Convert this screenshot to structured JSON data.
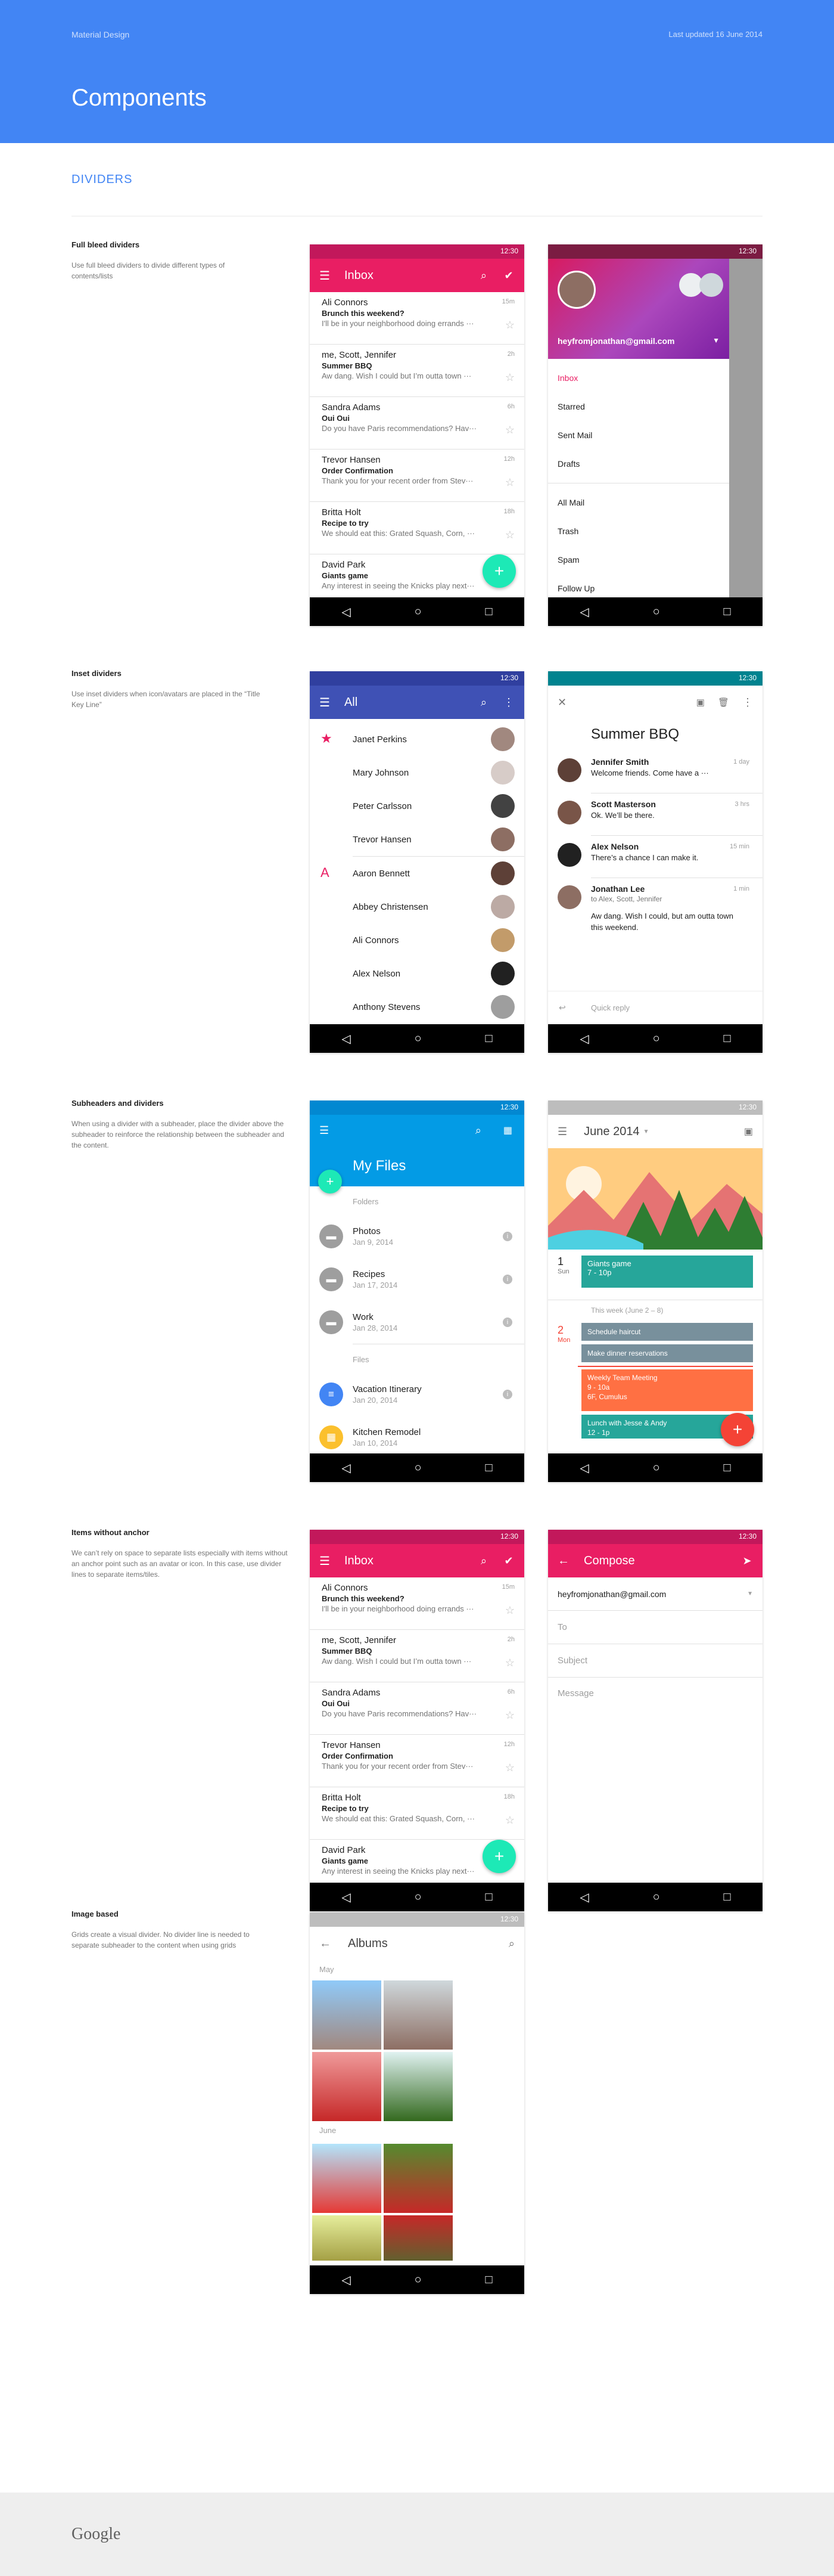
{
  "header": {
    "brand": "Material Design",
    "updated": "Last updated 16 June 2014",
    "title": "Components"
  },
  "section_title": "DIVIDERS",
  "colors": {
    "blue": "#4285f4",
    "pink": "#e91e63",
    "indigo": "#3f51b5",
    "teal": "#00acc1",
    "lightblue": "#039be5",
    "fab_cyan": "#1de9b6",
    "coral": "#f44336"
  },
  "nav_icons": [
    "back-icon",
    "home-icon",
    "recents-icon"
  ],
  "nav_glyphs": [
    "◁",
    "○",
    "□"
  ],
  "status_time": "12:30",
  "sections": [
    {
      "title": "Full bleed dividers",
      "desc": "Use full bleed dividers to divide different types of contents/lists"
    },
    {
      "title": "Inset dividers",
      "desc": "Use inset dividers when icon/avatars are placed in the “Title Key Line”"
    },
    {
      "title": "Subheaders and dividers",
      "desc": "When using a divider with a subheader, place the divider above the subheader to reinforce the relationship between the subheader and the content."
    },
    {
      "title": "Items without anchor",
      "desc": "We can’t rely on space to separate lists especially with items without an anchor point such as an avatar or icon. In this case, use divider lines to separate items/tiles."
    },
    {
      "title": "Image based",
      "desc": "Grids create a visual divider. No divider line is needed to separate subheader to the content when using grids"
    }
  ],
  "inbox": {
    "title": "Inbox",
    "mails": [
      {
        "name": "Ali Connors",
        "subject": "Brunch this weekend?",
        "preview": "I'll be in your neighborhood doing errands ···",
        "time": "15m"
      },
      {
        "name": "me, Scott, Jennifer",
        "subject": "Summer BBQ",
        "preview": "Aw dang. Wish I could but I’m outta town ···",
        "time": "2h"
      },
      {
        "name": "Sandra Adams",
        "subject": "Oui Oui",
        "preview": "Do you have Paris recommendations? Hav···",
        "time": "6h"
      },
      {
        "name": "Trevor Hansen",
        "subject": "Order Confirmation",
        "preview": "Thank you for your recent order from Stev···",
        "time": "12h"
      },
      {
        "name": "Britta Holt",
        "subject": "Recipe to try",
        "preview": "We should eat this: Grated Squash, Corn, ···",
        "time": "18h"
      },
      {
        "name": "David Park",
        "subject": "Giants game",
        "preview": "Any interest in seeing the Knicks play next···",
        "time": ""
      }
    ]
  },
  "drawer": {
    "email": "heyfromjonathan@gmail.com",
    "items": [
      "Inbox",
      "Starred",
      "Sent Mail",
      "Drafts",
      "All Mail",
      "Trash",
      "Spam",
      "Follow Up"
    ]
  },
  "contacts": {
    "title": "All",
    "groups": [
      {
        "letter": "★",
        "names": [
          "Janet Perkins",
          "Mary Johnson",
          "Peter Carlsson",
          "Trevor Hansen"
        ]
      },
      {
        "letter": "A",
        "names": [
          "Aaron Bennett",
          "Abbey Christensen",
          "Ali Connors",
          "Alex Nelson",
          "Anthony Stevens"
        ]
      }
    ]
  },
  "thread": {
    "title": "Summer BBQ",
    "messages": [
      {
        "name": "Jennifer Smith",
        "text": "Welcome friends. Come have a ···",
        "time": "1 day"
      },
      {
        "name": "Scott Masterson",
        "text": "Ok. We’ll be there.",
        "time": "3 hrs"
      },
      {
        "name": "Alex Nelson",
        "text": "There’s a chance I can make it.",
        "time": "15 min"
      },
      {
        "name": "Jonathan Lee",
        "to": "to Alex, Scott, Jennifer",
        "text": "Aw dang. Wish I could, but am outta town this weekend.",
        "time": "1 min"
      }
    ],
    "reply": "Quick reply"
  },
  "files": {
    "title": "My Files",
    "folders_label": "Folders",
    "files_label": "Files",
    "folders": [
      {
        "name": "Photos",
        "date": "Jan 9, 2014"
      },
      {
        "name": "Recipes",
        "date": "Jan 17, 2014"
      },
      {
        "name": "Work",
        "date": "Jan 28, 2014"
      }
    ],
    "files": [
      {
        "name": "Vacation Itinerary",
        "date": "Jan 20, 2014"
      },
      {
        "name": "Kitchen Remodel",
        "date": "Jan 10, 2014"
      }
    ]
  },
  "calendar": {
    "month": "June 2014",
    "day1": {
      "num": "1",
      "dow": "Sun"
    },
    "event1": "Giants game",
    "event1_time": "7 - 10p",
    "week_label": "This week (June 2 – 8)",
    "day2": {
      "num": "2",
      "dow": "Mon"
    },
    "events2": [
      "Schedule haircut",
      "Make dinner reservations"
    ],
    "event3": "Weekly Team Meeting",
    "event3_time": "9 - 10a",
    "event3_place": "6F, Cumulus",
    "event4": "Lunch with Jesse & Andy",
    "event4_time": "12 - 1p"
  },
  "compose": {
    "title": "Compose",
    "from": "heyfromjonathan@gmail.com",
    "to": "To",
    "subject": "Subject",
    "message": "Message"
  },
  "albums": {
    "title": "Albums",
    "may": "May",
    "june": "June"
  },
  "footer": {
    "logo": "Google"
  }
}
